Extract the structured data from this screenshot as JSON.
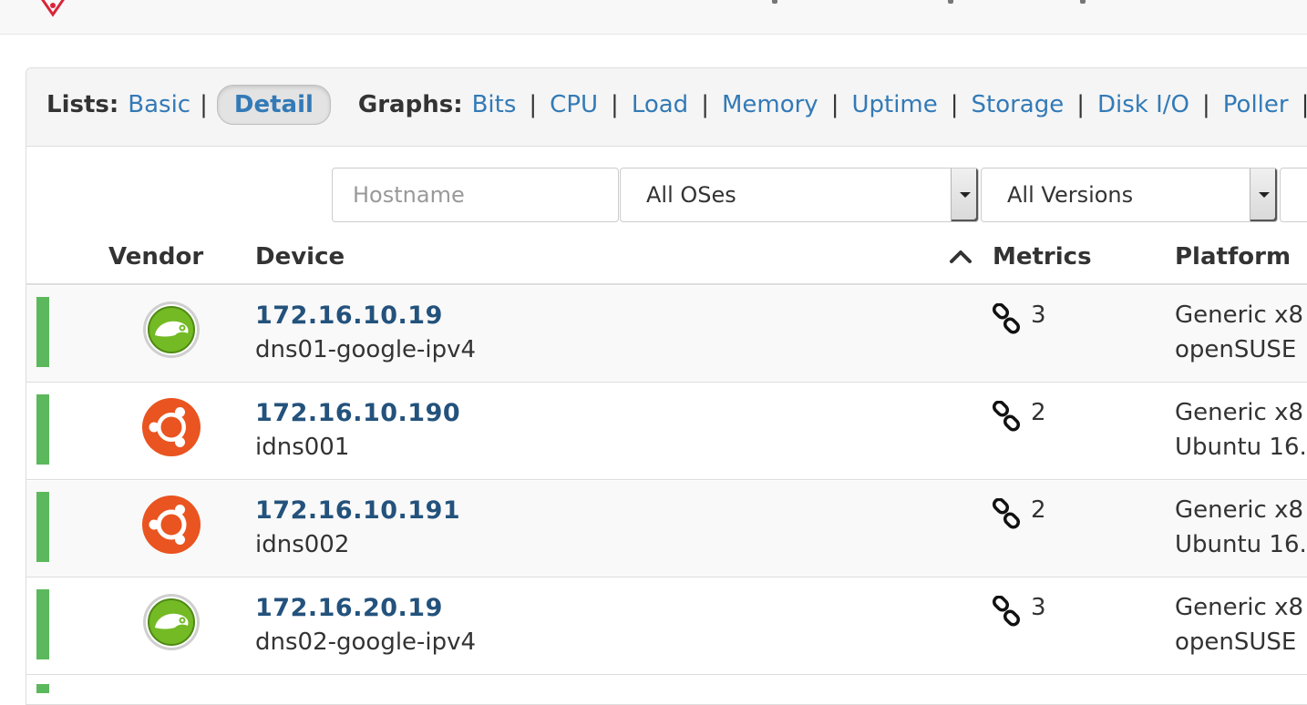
{
  "heading": {
    "lists_label": "Lists:",
    "lists": [
      "Basic",
      "Detail"
    ],
    "graphs_label": "Graphs:",
    "graphs": [
      "Bits",
      "CPU",
      "Load",
      "Memory",
      "Uptime",
      "Storage",
      "Disk I/O",
      "Poller"
    ]
  },
  "filters": {
    "hostname_placeholder": "Hostname",
    "os_selected": "All OSes",
    "version_selected": "All Versions"
  },
  "table": {
    "headers": {
      "vendor": "Vendor",
      "device": "Device",
      "metrics": "Metrics",
      "platform": "Platform"
    },
    "rows": [
      {
        "ip": "172.16.10.19",
        "hostname": "dns01-google-ipv4",
        "metrics": "3",
        "platform_line1": "Generic x8",
        "platform_line2": "openSUSE",
        "vendor_icon": "opensuse-icon",
        "status_color": "#5cb85c"
      },
      {
        "ip": "172.16.10.190",
        "hostname": "idns001",
        "metrics": "2",
        "platform_line1": "Generic x8",
        "platform_line2": "Ubuntu 16.",
        "vendor_icon": "ubuntu-icon",
        "status_color": "#5cb85c"
      },
      {
        "ip": "172.16.10.191",
        "hostname": "idns002",
        "metrics": "2",
        "platform_line1": "Generic x8",
        "platform_line2": "Ubuntu 16.",
        "vendor_icon": "ubuntu-icon",
        "status_color": "#5cb85c"
      },
      {
        "ip": "172.16.20.19",
        "hostname": "dns02-google-ipv4",
        "metrics": "3",
        "platform_line1": "Generic x8",
        "platform_line2": "openSUSE",
        "vendor_icon": "opensuse-icon",
        "status_color": "#5cb85c"
      }
    ]
  },
  "colors": {
    "link": "#337ab7",
    "device_link": "#23527c",
    "status_up": "#5cb85c",
    "ubuntu": "#e95420",
    "opensuse": "#73ba25"
  }
}
